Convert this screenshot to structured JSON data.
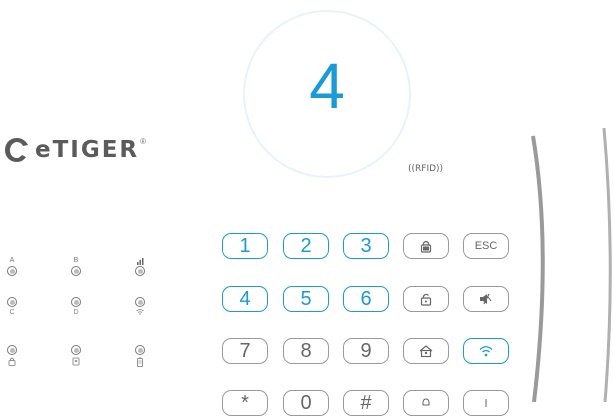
{
  "display": {
    "pressed_key": "4"
  },
  "brand": {
    "name": "eTIGER",
    "reg": "®"
  },
  "rfid": {
    "label": "((RFID))"
  },
  "indicators": [
    {
      "id": "a",
      "top": "A",
      "bottom": ""
    },
    {
      "id": "b",
      "top": "B",
      "bottom": ""
    },
    {
      "id": "signal",
      "top": "▐█",
      "bottom": ""
    },
    {
      "id": "c",
      "top": "",
      "bottom": "C"
    },
    {
      "id": "d",
      "top": "",
      "bottom": "D"
    },
    {
      "id": "wifi",
      "top": "",
      "bottom": "◠"
    },
    {
      "id": "lock",
      "top": "",
      "bottom": "🔒"
    },
    {
      "id": "tamper",
      "top": "",
      "bottom": "□"
    },
    {
      "id": "battery",
      "top": "",
      "bottom": "▮"
    }
  ],
  "keys": {
    "k1": "1",
    "k2": "2",
    "k3": "3",
    "esc": "ESC",
    "k4": "4",
    "k5": "5",
    "k6": "6",
    "k7": "7",
    "k8": "8",
    "k9": "9",
    "star": "*",
    "k0": "0",
    "hash": "#"
  },
  "colors": {
    "accent": "#1a9ad6",
    "key_border": "#9a9a9a",
    "text": "#555555"
  }
}
